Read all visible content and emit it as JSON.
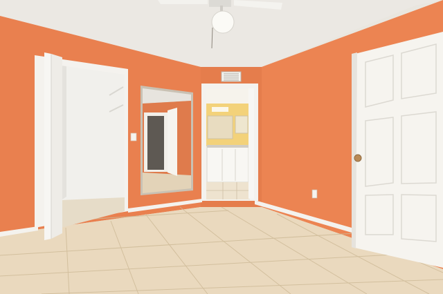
{
  "scene": {
    "description_free": true,
    "room": "empty bedroom",
    "colors": {
      "wall": "#e9804f",
      "wall_shadow": "#d86f3f",
      "ceiling": "#ebe8e3",
      "floor": "#ead9be",
      "grout": "#cdb996",
      "trim": "#f4f2ee",
      "door": "#f6f4ef",
      "closet_interior": "#f1f0ec",
      "bath_wall": "#f3d27a"
    },
    "icons": [
      "ceiling-fan-icon",
      "hvac-vent-icon",
      "outlet-icon",
      "light-switch-icon",
      "door-knob-icon"
    ]
  }
}
